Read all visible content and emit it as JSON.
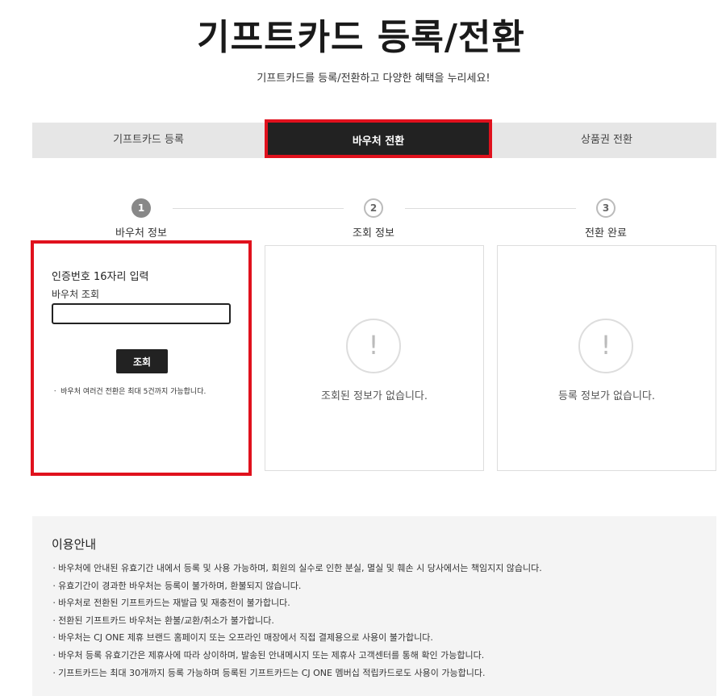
{
  "header": {
    "title": "기프트카드 등록/전환",
    "subtitle": "기프트카드를 등록/전환하고 다양한 혜택을 누리세요!"
  },
  "tabs": [
    {
      "label": "기프트카드 등록",
      "active": false
    },
    {
      "label": "바우처 전환",
      "active": true
    },
    {
      "label": "상품권 전환",
      "active": false
    }
  ],
  "steps": [
    {
      "number": "1",
      "label": "바우처 정보",
      "active": true
    },
    {
      "number": "2",
      "label": "조회 정보",
      "active": false
    },
    {
      "number": "3",
      "label": "전환 완료",
      "active": false
    }
  ],
  "voucher_panel": {
    "heading": "인증번호 16자리 입력",
    "sub_label": "바우처 조회",
    "input_value": "",
    "button_label": "조회",
    "note": "ㆍ 바우처 여러건 전환은 최대 5건까지 가능합니다."
  },
  "lookup_panel": {
    "icon": "!",
    "empty_message": "조회된 정보가 없습니다."
  },
  "complete_panel": {
    "icon": "!",
    "empty_message": "등록 정보가 없습니다."
  },
  "usage_info": {
    "title": "이용안내",
    "items": [
      "ㆍ바우처에 안내된 유효기간 내에서 등록 및 사용 가능하며, 회원의 실수로 인한 분실, 멸실 및 훼손 시 당사에서는 책임지지 않습니다.",
      "ㆍ유효기간이 경과한 바우처는 등록이 불가하며, 환불되지 않습니다.",
      "ㆍ바우처로 전환된 기프트카드는 재발급 및 재충전이 불가합니다.",
      "ㆍ전환된 기프트카드 바우처는 환불/교환/취소가 불가합니다.",
      "ㆍ바우처는 CJ ONE 제휴 브랜드 홈페이지 또는 오프라인 매장에서 직접 결제용으로 사용이 불가합니다.",
      "ㆍ바우처 등록 유효기간은 제휴사에 따라 상이하며, 발송된 안내메시지 또는 제휴사 고객센터를 통해 확인 가능합니다.",
      "ㆍ기프트카드는 최대 30개까지 등록 가능하며 등록된 기프트카드는 CJ ONE 멤버십 적립카드로도 사용이 가능합니다."
    ]
  },
  "colors": {
    "highlight_border": "#e0111d",
    "active_tab_bg": "#222222",
    "info_bg": "#f4f4f4"
  }
}
